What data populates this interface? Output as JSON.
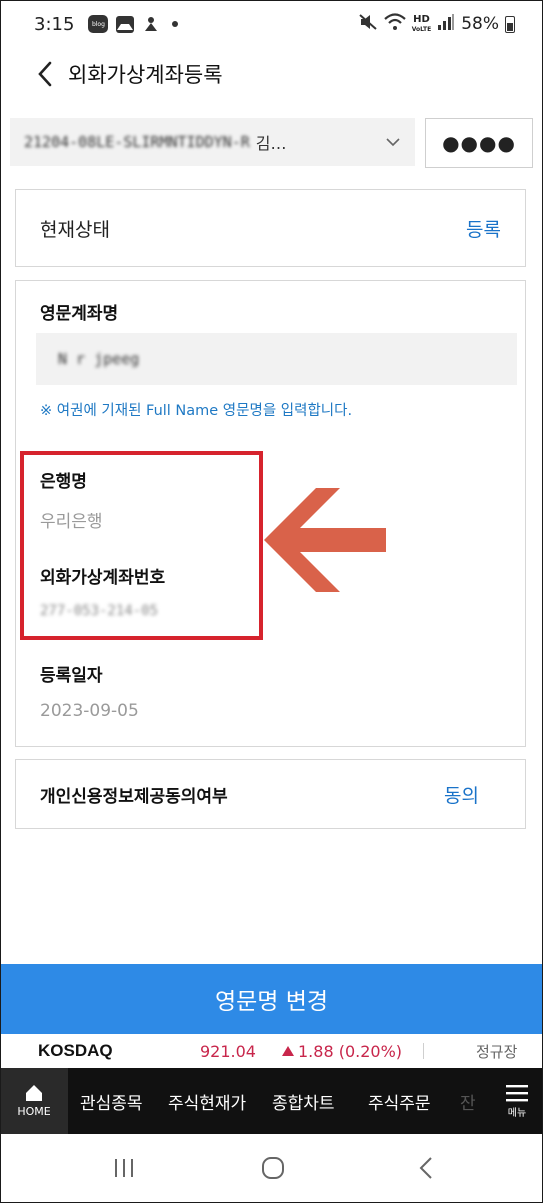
{
  "status_bar": {
    "time": "3:15",
    "battery": "58%",
    "icons": [
      "blog-icon",
      "gallery-icon",
      "app-icon",
      "dot-icon",
      "mute-icon",
      "wifi-icon",
      "hd-voice-icon",
      "signal-icon",
      "battery-icon"
    ],
    "hd_label": "HD"
  },
  "header": {
    "title": "외화가상계좌등록",
    "back_icon": "chevron-left-icon"
  },
  "account": {
    "number_masked": "21204-08LE-SLIRMNTIDDYN-R",
    "owner": "김…",
    "password_dots": "●●●●"
  },
  "status_card": {
    "label": "현재상태",
    "value": "등록"
  },
  "detail": {
    "english_name_label": "영문계좌명",
    "english_name_value": "N   r jpeeg",
    "hint": "※ 여권에 기재된 Full Name 영문명을 입력합니다.",
    "bank_label": "은행명",
    "bank_value": "우리은행",
    "virtual_account_label": "외화가상계좌번호",
    "virtual_account_value": "277-053-214-05",
    "reg_date_label": "등록일자",
    "reg_date_value": "2023-09-05"
  },
  "consent": {
    "label": "개인신용정보제공동의여부",
    "value": "동의"
  },
  "change_button": {
    "label": "영문명 변경"
  },
  "ticker": {
    "name": "KOSDAQ",
    "price": "921.04",
    "change": "1.88 (0.20%)",
    "status": "정규장",
    "change_color": "#c8264b"
  },
  "bottom_nav": {
    "home_label": "HOME",
    "items": [
      "관심종목",
      "주식현재가",
      "종합차트",
      "주식주문",
      "잔"
    ],
    "menu_label": "메뉴"
  },
  "colors": {
    "accent": "#2e8ae6",
    "link": "#1a73c9",
    "highlight": "#d6232d",
    "arrow": "#d9624a"
  }
}
